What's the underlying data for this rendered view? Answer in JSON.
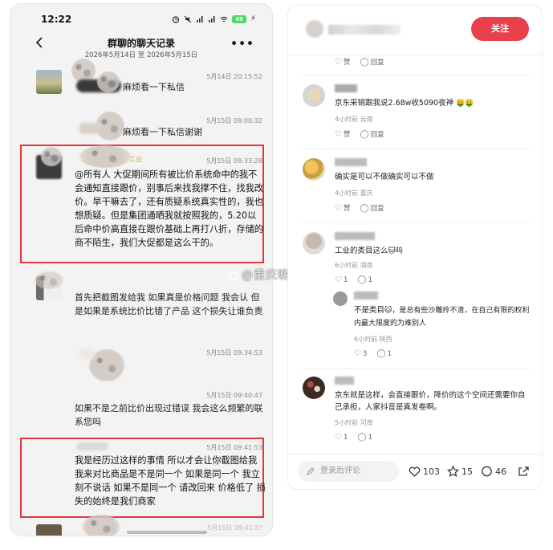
{
  "left": {
    "status_time": "12:22",
    "battery": "49",
    "title": "群聊的聊天记录",
    "subtitle": "2026年5月14日 至 2026年5月15日",
    "messages": [
      {
        "time": "5月14日 20:15:52",
        "text": "麻烦看一下私信"
      },
      {
        "time": "5月15日 09:00:32",
        "text": "麻烦看一下私信谢谢"
      },
      {
        "time": "5月15日 09:33:28",
        "name_suffix": "工业",
        "text": "@所有人 大促期间所有被比价系统命中的我不会通知直接跟价，别事后来找我撑不住，找我改价。早干嘛去了，还有质疑系统真实性的，我也想质疑。但是集团通晒我就按照我的，5.20以后命中价高直接在跟价基础上再打八折，存储的商不陌生，我们大促都是这么干的。"
      },
      {
        "time": "",
        "text": "首先把截图发给我  如果真是价格问题  我会认  但是如果是系统比价比错了产品  这个损失让谁负责"
      },
      {
        "time": "5月15日 09:34:53",
        "text": ""
      },
      {
        "time": "5月15日 09:40:47",
        "text": "如果不是之前比价出现过错误  我会这么频繁的联系您吗"
      },
      {
        "time": "5月15日 09:41:53",
        "text": "我是经历过这样的事情  所以才会让你截图给我  我来对比商品是不是同一个  如果是同一个 我立刻不说话  如果不是同一个  请改回来 价格低了  损失的始终是我们商家"
      }
    ],
    "last_peek_time": "5月15日 09:41:5?"
  },
  "watermark": "@重庆晚报",
  "right": {
    "follow_label": "关注",
    "top_actions": {
      "like": "赞",
      "reply": "回复"
    },
    "comments": [
      {
        "text": "京东采销跟我说2.68w收5090夜神",
        "emoji": "🤑🤑",
        "meta": "4小时前  云南",
        "like": "赞",
        "reply": "回复",
        "like_count": "",
        "reply_count": ""
      },
      {
        "text": "确实是可以不做确实可以不做",
        "emoji": "",
        "meta": "4小时前  重庆",
        "like": "赞",
        "reply": "回复",
        "like_count": "",
        "reply_count": ""
      },
      {
        "text": "工业的类目这么",
        "emoji": "🐱吗",
        "meta": "6小时前  湖南",
        "like": "",
        "reply": "",
        "like_count": "1",
        "reply_count": "1"
      },
      {
        "text": "不是类目",
        "emoji": "🐱，是总有些沙雕拎不清，在自己有限的权利内最大限度的为难别人",
        "meta": "6小时前  陕西",
        "like": "",
        "reply": "",
        "like_count": "3",
        "reply_count": "1"
      },
      {
        "text": "京东就是这样，会直接跟价，降价的这个空间还需要你自己承担，人家抖音是真发卷啊。",
        "emoji": "",
        "meta": "5小时前  河南",
        "like": "",
        "reply": "",
        "like_count": "1",
        "reply_count": "1"
      }
    ],
    "bottom": {
      "input_placeholder": "登录后评论",
      "likes": "103",
      "favorites": "15",
      "comments": "46"
    }
  }
}
